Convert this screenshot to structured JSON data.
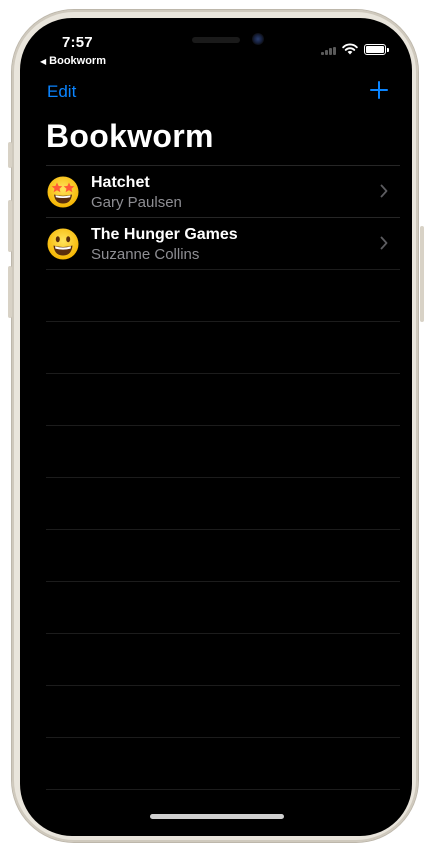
{
  "status_bar": {
    "time": "7:57",
    "back_app_label": "Bookworm",
    "signal_icon": "signal-icon",
    "wifi_icon": "wifi-icon",
    "battery_icon": "battery-icon"
  },
  "nav": {
    "edit_label": "Edit",
    "add_icon": "plus-icon",
    "title": "Bookworm"
  },
  "books": [
    {
      "title": "Hatchet",
      "author": "Gary Paulsen",
      "rating_icon": "star-struck-emoji-icon"
    },
    {
      "title": "The Hunger Games",
      "author": "Suzanne Collins",
      "rating_icon": "grinning-emoji-icon"
    }
  ],
  "colors": {
    "accent": "#0a84ff",
    "background": "#000000",
    "secondary_text": "#8e8e93"
  }
}
